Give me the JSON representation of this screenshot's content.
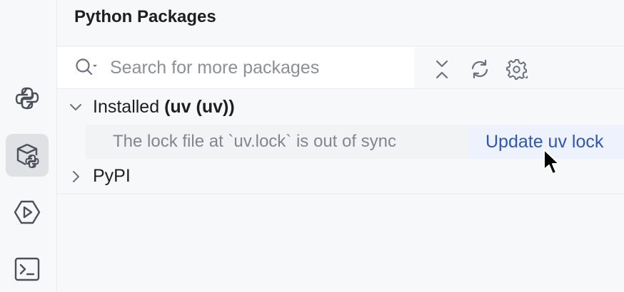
{
  "panel": {
    "title": "Python Packages"
  },
  "search": {
    "placeholder": "Search for more packages"
  },
  "toolbar": {
    "collapse_icon": "collapse-all-icon",
    "refresh_icon": "refresh-icon",
    "settings_icon": "gear-icon"
  },
  "sidebar": {
    "items": [
      {
        "icon": "python-icon"
      },
      {
        "icon": "python-packages-icon",
        "active": true
      },
      {
        "icon": "run-icon"
      },
      {
        "icon": "terminal-icon"
      }
    ]
  },
  "installed": {
    "label": "Installed",
    "env": "(uv (uv))",
    "warning": "The lock file at `uv.lock` is out of sync",
    "action": "Update uv lock"
  },
  "pypi": {
    "label": "PyPI"
  },
  "colors": {
    "link": "#2e58b5",
    "active_bg": "#dfe1e5"
  }
}
